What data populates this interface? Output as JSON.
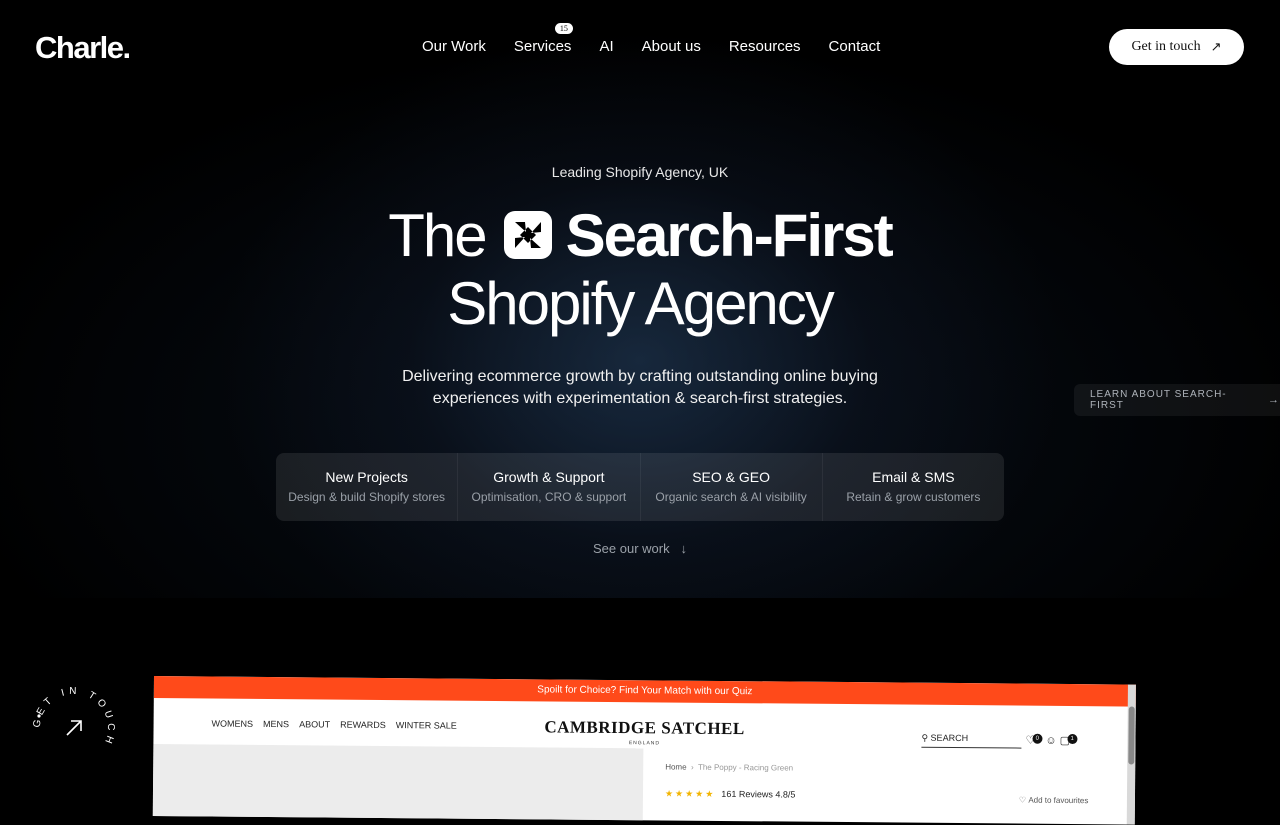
{
  "brand": {
    "logo": "Charle."
  },
  "nav": {
    "items": [
      "Our Work",
      "Services",
      "AI",
      "About us",
      "Resources",
      "Contact"
    ],
    "services_badge": "15",
    "cta_label": "Get in touch",
    "cta_icon": "arrow-up-right-icon"
  },
  "hero": {
    "eyebrow": "Leading Shopify Agency, UK",
    "headline_part1": "The",
    "headline_part2": "Search-First",
    "headline_line2": "Shopify Agency",
    "subtitle": "Delivering ecommerce growth by crafting outstanding online buying experiences with experimentation & search-first strategies."
  },
  "services": [
    {
      "title": "New Projects",
      "desc": "Design & build Shopify stores"
    },
    {
      "title": "Growth & Support",
      "desc": "Optimisation, CRO & support"
    },
    {
      "title": "SEO & GEO",
      "desc": "Organic search & AI visibility"
    },
    {
      "title": "Email & SMS",
      "desc": "Retain & grow customers"
    }
  ],
  "see_work": "See our work",
  "side_tab": "LEARN ABOUT SEARCH-FIRST",
  "round_badge": "GET IN TOUCH",
  "preview": {
    "promo": "Spoilt for Choice? Find Your Match with our Quiz",
    "nav": [
      "WOMENS",
      "MENS",
      "ABOUT",
      "REWARDS",
      "WINTER SALE"
    ],
    "logo": "CAMBRIDGE SATCHEL",
    "logo_sub": "ENGLAND",
    "search": "SEARCH",
    "wishlist_count": "0",
    "cart_count": "1",
    "crumb_home": "Home",
    "crumb_current": "The Poppy - Racing Green",
    "reviews": "161 Reviews 4.8/5",
    "fav": "Add to favourites"
  },
  "colors": {
    "background": "#000000",
    "promo": "#ff4a1a",
    "stars": "#f2b400"
  }
}
